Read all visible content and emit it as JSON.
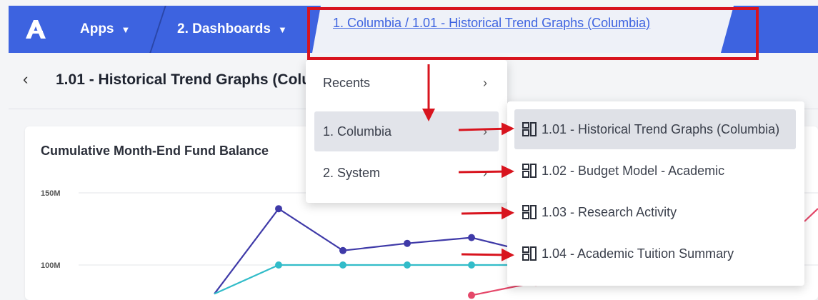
{
  "nav": {
    "logo": "logo-icon",
    "apps_label": "Apps",
    "dashboards_label": "2. Dashboards",
    "breadcrumb_link": "1. Columbia / 1.01 - Historical Trend Graphs (Columbia)"
  },
  "page": {
    "title": "1.01 - Historical Trend Graphs (Columbia)"
  },
  "chart": {
    "title": "Cumulative Month-End Fund Balance"
  },
  "chart_data": {
    "type": "line",
    "title": "Cumulative Month-End Fund Balance",
    "y_ticks": [
      "150M",
      "100M"
    ],
    "ylim": [
      80,
      155
    ],
    "grid": true,
    "x": [
      1,
      2,
      3,
      4,
      5,
      6,
      7
    ],
    "series": [
      {
        "color": "#3f3aa8",
        "values": [
          80,
          139,
          110,
          115,
          119,
          108,
          null
        ]
      },
      {
        "color": "#32bcc9",
        "values": [
          80,
          100,
          100,
          100,
          100,
          100,
          null
        ]
      },
      {
        "color": "#e5486a",
        "values": [
          null,
          null,
          null,
          null,
          79,
          88,
          null
        ]
      }
    ]
  },
  "menu_level1": {
    "items": [
      {
        "label": "Recents",
        "arrow": "›"
      },
      {
        "label": "1. Columbia",
        "arrow": "›"
      },
      {
        "label": "2. System",
        "arrow": "›"
      }
    ]
  },
  "menu_level2": {
    "items": [
      {
        "label": "1.01 - Historical Trend Graphs (Columbia)"
      },
      {
        "label": "1.02 - Budget Model - Academic"
      },
      {
        "label": "1.03 - Research Activity"
      },
      {
        "label": "1.04 - Academic Tuition Summary"
      }
    ]
  },
  "colors": {
    "nav_bg": "#3d63e0",
    "annotation": "#d8141e",
    "link": "#3d63e0"
  }
}
